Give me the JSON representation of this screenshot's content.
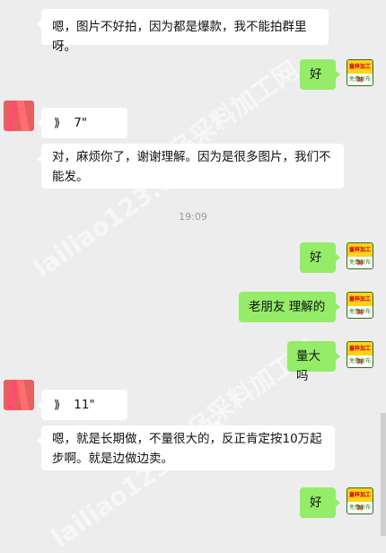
{
  "messages": [
    {
      "id": "m1",
      "dir": "in",
      "text": "嗯，图片不好拍，因为都是爆款，我不能拍群里呀。"
    },
    {
      "id": "m2",
      "dir": "out",
      "text": "好"
    },
    {
      "id": "m3",
      "dir": "in",
      "type": "voice",
      "text": "7\""
    },
    {
      "id": "m4",
      "dir": "in",
      "text": "对，麻烦你了，谢谢理解。因为是很多图片，我们不能发。"
    },
    {
      "id": "m5",
      "dir": "out",
      "text": "好"
    },
    {
      "id": "m6",
      "dir": "out",
      "text": "老朋友 理解的"
    },
    {
      "id": "m7",
      "dir": "out",
      "text": "量大吗"
    },
    {
      "id": "m8",
      "dir": "in",
      "type": "voice",
      "text": "11\""
    },
    {
      "id": "m9",
      "dir": "in",
      "text": "嗯，就是长期做，不量很大的，反正肯定按10万起步啊。就是边做边卖。"
    },
    {
      "id": "m10",
      "dir": "out",
      "text": "好"
    }
  ],
  "timestamp": "19:09",
  "avatar_out": {
    "top": "童梓加工网",
    "bottom": "免费发布"
  },
  "watermark": {
    "cn": "义乌采料加工网",
    "en": "lailiao123.com"
  },
  "colors": {
    "background": "#ededed",
    "outgoing_bubble": "#95ec69",
    "incoming_bubble": "#ffffff"
  },
  "icons": {
    "voice": "voice-wave-icon"
  }
}
